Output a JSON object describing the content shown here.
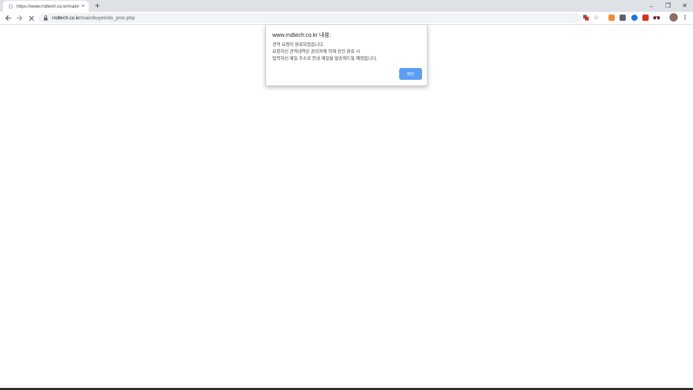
{
  "tab": {
    "title": "https://www.rndtech.co.kr/main/",
    "close_glyph": "×",
    "new_tab_glyph": "+"
  },
  "window": {
    "minimize_glyph": "–",
    "restore_glyph": "❐",
    "close_glyph": "✕"
  },
  "address": {
    "host": "rndtech.co.kr",
    "path": "/main/buyerinfo_proc.php"
  },
  "dialog": {
    "title": "www.rndtech.co.kr 내용:",
    "lines": [
      "견적 요청이 완료되었습니다.",
      "요청하신 견적내역은 관리자에 의해 승인 완료 시",
      "입력하신 메일 주소로 안내 메일을 발송해드릴 예정입니다."
    ],
    "ok_label": "확인"
  },
  "colors": {
    "tabstrip": "#dee1e6",
    "omnibox": "#f1f3f4",
    "ok_button": "#5b9cf5"
  },
  "icons": [
    "back-icon",
    "forward-icon",
    "stop-loading-icon",
    "lock-icon",
    "translate-icon",
    "star-icon",
    "extension-icon",
    "profile-avatar",
    "menu-icon"
  ]
}
